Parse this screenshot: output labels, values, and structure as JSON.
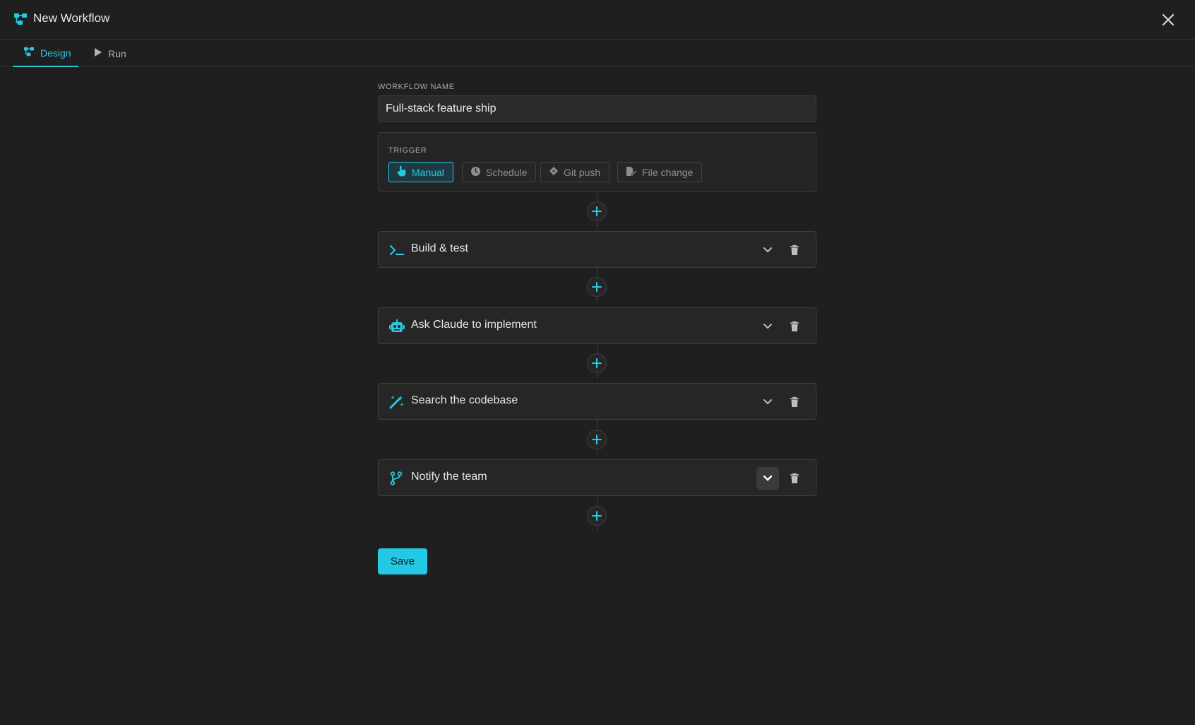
{
  "header": {
    "title": "New Workflow",
    "app_icon": "workflow-icon",
    "close_icon": "close-icon"
  },
  "tabs": [
    {
      "label": "Design",
      "icon": "workflow-icon",
      "active": true
    },
    {
      "label": "Run",
      "icon": "play-icon",
      "active": false
    }
  ],
  "workflow_name": {
    "label": "WORKFLOW NAME",
    "value": "Full-stack feature ship"
  },
  "trigger": {
    "label": "TRIGGER",
    "options": [
      {
        "label": "Manual",
        "icon": "hand-pointer-icon",
        "active": true
      },
      {
        "label": "Schedule",
        "icon": "clock-icon",
        "active": false
      },
      {
        "label": "Git push",
        "icon": "git-diamond-icon",
        "active": false
      },
      {
        "label": "File change",
        "icon": "file-edit-icon",
        "active": false
      }
    ]
  },
  "steps": [
    {
      "title": "Build & test",
      "icon": "terminal-icon"
    },
    {
      "title": "Ask Claude to implement",
      "icon": "robot-icon"
    },
    {
      "title": "Search the codebase",
      "icon": "magic-wand-icon"
    },
    {
      "title": "Notify the team",
      "icon": "branch-icon"
    }
  ],
  "save_label": "Save",
  "colors": {
    "accent": "#2bc6e0",
    "background": "#1f1f1f",
    "panel": "#262626",
    "border": "#3f3f3f"
  }
}
